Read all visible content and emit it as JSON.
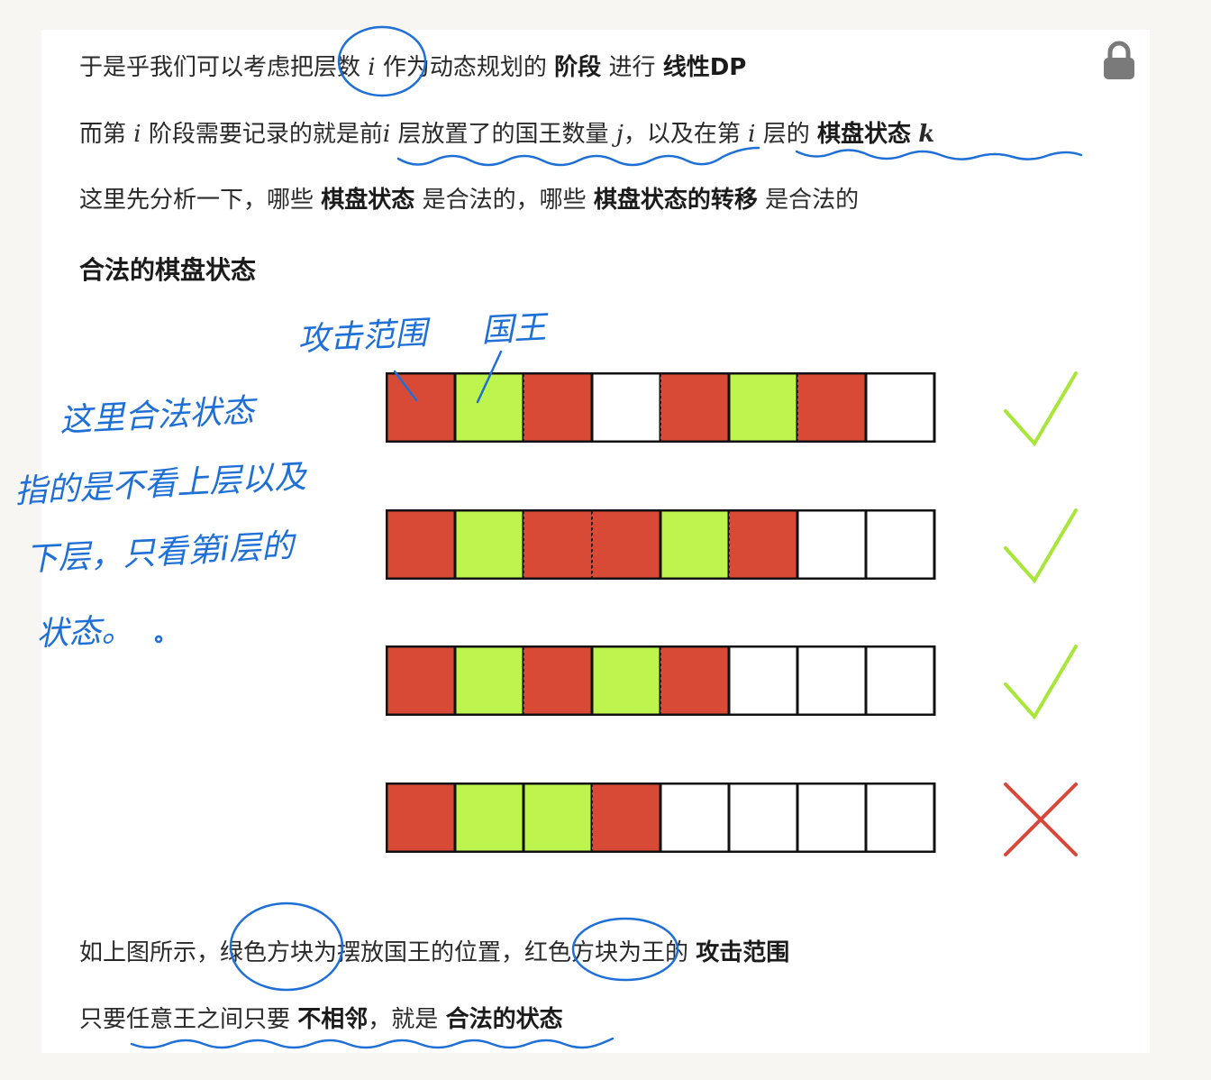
{
  "paragraphs": {
    "p1": {
      "t1": "于是乎我们可以考虑把层数",
      "var_i": "i",
      "t2": "作为动态规划的",
      "b1": "阶段",
      "t3": "进行",
      "b2": "线性DP"
    },
    "p2": {
      "t1": "而第",
      "var_i1": "i",
      "t2": "阶段需要记录的就是前",
      "var_i2": "i",
      "t3": "层放置了的国王数量",
      "var_j": "j",
      "t4": "，以及在第",
      "var_i3": "i",
      "t5": "层的",
      "b1": "棋盘状态",
      "var_k": "k"
    },
    "p3": {
      "t1": "这里先分析一下，哪些",
      "b1": "棋盘状态",
      "t2": "是合法的，哪些",
      "b2": "棋盘状态的转移",
      "t3": "是合法的"
    },
    "heading": "合法的棋盘状态",
    "p4": {
      "t1": "如上图所示，绿色方块为摆放国王的位置，红色方块为王的",
      "b1": "攻击范围"
    },
    "p5": {
      "t1": "只要任意王之间只要",
      "b1": "不相邻",
      "t2": "，就是",
      "b2": "合法的状态"
    }
  },
  "colors": {
    "red": "#d84a35",
    "green": "#bdf44e",
    "empty": "#ffffff",
    "check": "#a8e63a",
    "cross": "#d9473a",
    "ink": "#1e6fd6"
  },
  "boards": [
    {
      "cells": [
        "red",
        "green",
        "red",
        "empty",
        "red",
        "green",
        "red",
        "empty"
      ],
      "verdict": "valid"
    },
    {
      "cells": [
        "red",
        "green",
        "red",
        "red",
        "green",
        "red",
        "empty",
        "empty"
      ],
      "verdict": "valid"
    },
    {
      "cells": [
        "red",
        "green",
        "red",
        "green",
        "red",
        "empty",
        "empty",
        "empty"
      ],
      "verdict": "valid"
    },
    {
      "cells": [
        "red",
        "green",
        "green",
        "red",
        "empty",
        "empty",
        "empty",
        "empty"
      ],
      "verdict": "invalid"
    }
  ],
  "handwriting": {
    "attack_label": "攻击范围",
    "king_label": "国王",
    "note_lines": [
      "这里合法状态",
      "指的是不看上层以及",
      "下层，只看第i层的",
      "状态。"
    ]
  },
  "icons": {
    "lock": "lock-icon"
  }
}
